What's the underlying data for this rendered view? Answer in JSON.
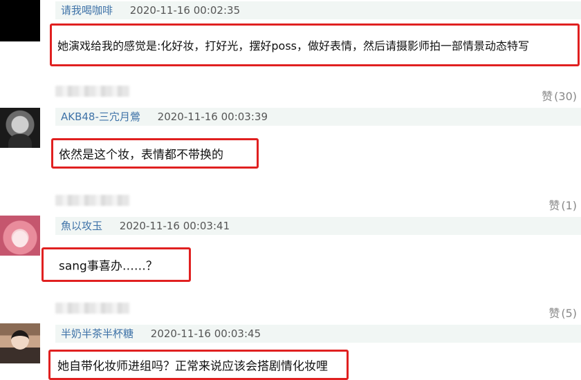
{
  "comments": [
    {
      "username": "请我喝咖啡",
      "time": "2020-11-16 00:02:35",
      "text": "她演戏给我的感觉是:化好妆，打好光，摆好poss，做好表情，然后请摄影师拍一部情景动态特写",
      "like_label": "赞",
      "like_count": "(30)"
    },
    {
      "username": "AKB48-三宂月鶯",
      "time": "2020-11-16 00:03:39",
      "text": "依然是这个妆，表情都不带换的",
      "like_label": "赞",
      "like_count": "(1)"
    },
    {
      "username": "魚以攻玉",
      "time": "2020-11-16 00:03:41",
      "text": "sang事喜办……？",
      "like_label": "赞",
      "like_count": "(5)"
    },
    {
      "username": "半奶半茶半杯糖",
      "time": "2020-11-16 00:03:45",
      "text": "她自带化妆师进组吗？正常来说应该会搭剧情化妆哩"
    }
  ],
  "colors": {
    "highlight_border": "#e02020",
    "username": "#3f73a8",
    "meta_background": "#f1f6f4"
  }
}
